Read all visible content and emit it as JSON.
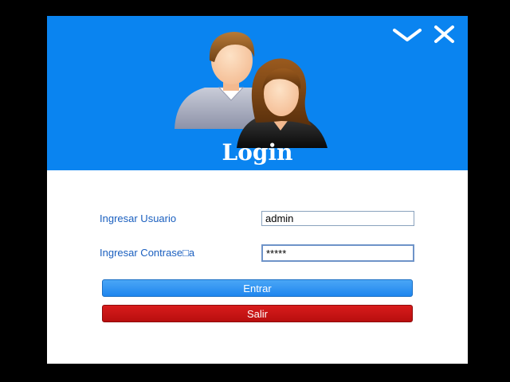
{
  "window": {
    "header_color": "#0a84f0",
    "title": "Login",
    "controls": {
      "minimize_icon": "chevron-down-icon",
      "close_icon": "close-icon"
    },
    "illustration_icon": "users-icon"
  },
  "form": {
    "username": {
      "label": "Ingresar Usuario",
      "value": "admin"
    },
    "password": {
      "label": "Ingresar Contrase□a",
      "value": "*****"
    },
    "enter_label": "Entrar",
    "exit_label": "Salir",
    "enter_color": "#2a8ef0",
    "exit_color": "#c81414"
  }
}
